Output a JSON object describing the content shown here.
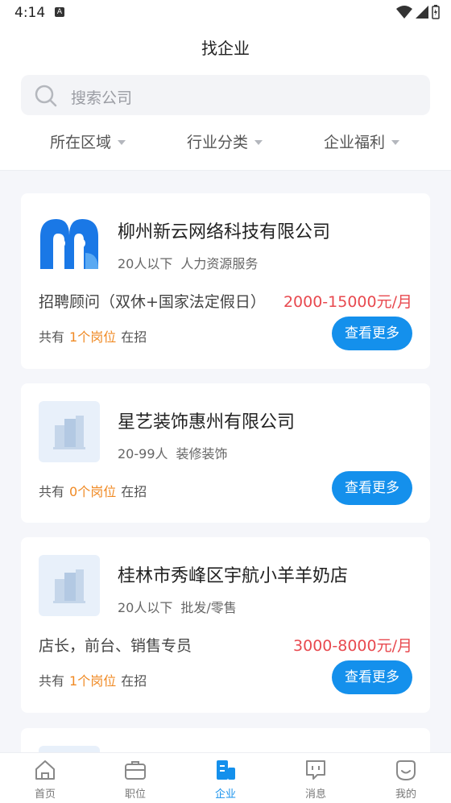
{
  "status": {
    "time": "4:14"
  },
  "header": {
    "title": "找企业",
    "search_placeholder": "搜索公司"
  },
  "filters": [
    "所在区域",
    "行业分类",
    "企业福利"
  ],
  "companies": [
    {
      "name": "柳州新云网络科技有限公司",
      "size": "20人以下",
      "industry": "人力资源服务",
      "job": "招聘顾问（双休+国家法定假日）",
      "salary": "2000-15000元/月",
      "count_prefix": "共有",
      "count": "1个岗位",
      "count_suffix": "在招",
      "button": "查看更多"
    },
    {
      "name": "星艺装饰惠州有限公司",
      "size": "20-99人",
      "industry": "装修装饰",
      "count_prefix": "共有",
      "count": "0个岗位",
      "count_suffix": "在招",
      "button": "查看更多"
    },
    {
      "name": "桂林市秀峰区宇航小羊羊奶店",
      "size": "20人以下",
      "industry": "批发/零售",
      "job": "店长，前台、销售专员",
      "salary": "3000-8000元/月",
      "count_prefix": "共有",
      "count": "1个岗位",
      "count_suffix": "在招",
      "button": "查看更多"
    }
  ],
  "tabs": [
    {
      "label": "首页",
      "icon": "home-icon"
    },
    {
      "label": "职位",
      "icon": "briefcase-icon"
    },
    {
      "label": "企业",
      "icon": "building-icon",
      "active": true
    },
    {
      "label": "消息",
      "icon": "message-icon"
    },
    {
      "label": "我的",
      "icon": "profile-icon"
    }
  ],
  "colors": {
    "accent": "#1490ec",
    "salary": "#e8494f",
    "count": "#f08a24"
  }
}
